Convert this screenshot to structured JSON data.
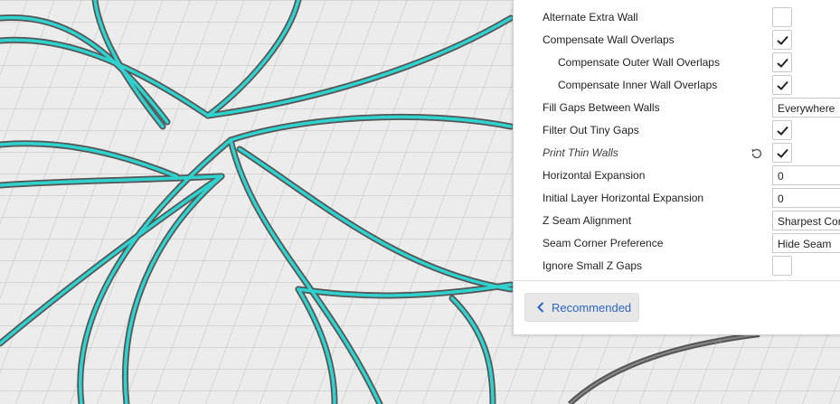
{
  "settings_panel": {
    "rows": [
      {
        "label": "Alternate Extra Wall",
        "type": "checkbox",
        "checked": false,
        "indent": false,
        "italic": false
      },
      {
        "label": "Compensate Wall Overlaps",
        "type": "checkbox",
        "checked": true,
        "indent": false,
        "italic": false
      },
      {
        "label": "Compensate Outer Wall Overlaps",
        "type": "checkbox",
        "checked": true,
        "indent": true,
        "italic": false
      },
      {
        "label": "Compensate Inner Wall Overlaps",
        "type": "checkbox",
        "checked": true,
        "indent": true,
        "italic": false
      },
      {
        "label": "Fill Gaps Between Walls",
        "type": "select",
        "value": "Everywhere",
        "indent": false,
        "italic": false
      },
      {
        "label": "Filter Out Tiny Gaps",
        "type": "checkbox",
        "checked": true,
        "indent": false,
        "italic": false
      },
      {
        "label": "Print Thin Walls",
        "type": "checkbox",
        "checked": true,
        "indent": false,
        "italic": true,
        "reset": true
      },
      {
        "label": "Horizontal Expansion",
        "type": "text",
        "value": "0",
        "indent": false,
        "italic": false
      },
      {
        "label": "Initial Layer Horizontal Expansion",
        "type": "text",
        "value": "0",
        "indent": false,
        "italic": false
      },
      {
        "label": "Z Seam Alignment",
        "type": "select",
        "value": "Sharpest Corner",
        "indent": false,
        "italic": false
      },
      {
        "label": "Seam Corner Preference",
        "type": "select",
        "value": "Hide Seam",
        "indent": false,
        "italic": false
      },
      {
        "label": "Ignore Small Z Gaps",
        "type": "checkbox",
        "checked": false,
        "indent": false,
        "italic": false
      }
    ],
    "recommended_label": "Recommended"
  },
  "icons": {
    "check": "checkmark-icon",
    "reset": "reset-icon",
    "back": "chevron-left-icon",
    "grip": "drag-handle-icon"
  },
  "colors": {
    "accent": "#2a66c7",
    "model": "#2ed3cf",
    "grid_bg": "#e9e9e9",
    "panel_bg": "#ffffff"
  }
}
